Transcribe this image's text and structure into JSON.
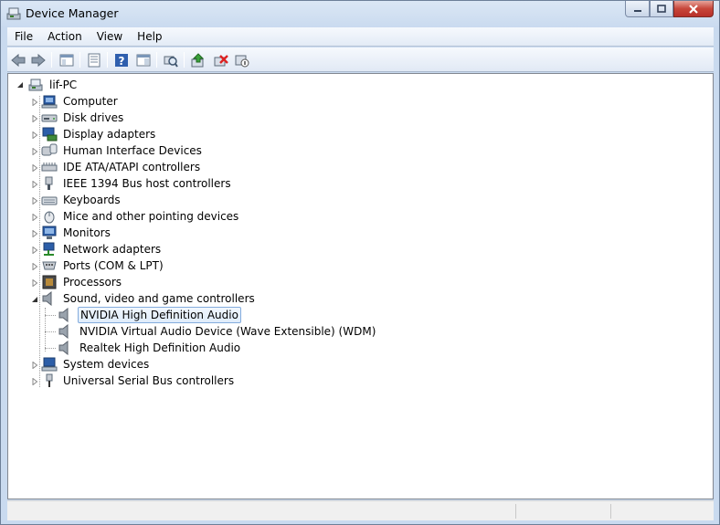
{
  "window": {
    "title": "Device Manager"
  },
  "menu": [
    "File",
    "Action",
    "View",
    "Help"
  ],
  "toolbar_icons": [
    "back-arrow-icon",
    "forward-arrow-icon",
    "show-hide-console-tree-icon",
    "properties-icon",
    "help-icon",
    "action-pane-icon",
    "scan-hardware-icon",
    "update-driver-icon",
    "uninstall-icon",
    "disable-device-icon"
  ],
  "tree": {
    "root": "lif-PC",
    "categories": [
      {
        "label": "Computer",
        "icon": "computer-icon"
      },
      {
        "label": "Disk drives",
        "icon": "disk-drive-icon"
      },
      {
        "label": "Display adapters",
        "icon": "display-adapter-icon"
      },
      {
        "label": "Human Interface Devices",
        "icon": "hid-icon"
      },
      {
        "label": "IDE ATA/ATAPI controllers",
        "icon": "ide-controller-icon"
      },
      {
        "label": "IEEE 1394 Bus host controllers",
        "icon": "ieee1394-icon"
      },
      {
        "label": "Keyboards",
        "icon": "keyboard-icon"
      },
      {
        "label": "Mice and other pointing devices",
        "icon": "mouse-icon"
      },
      {
        "label": "Monitors",
        "icon": "monitor-icon"
      },
      {
        "label": "Network adapters",
        "icon": "network-adapter-icon"
      },
      {
        "label": "Ports (COM & LPT)",
        "icon": "port-icon"
      },
      {
        "label": "Processors",
        "icon": "processor-icon"
      },
      {
        "label": "Sound, video and game controllers",
        "icon": "speaker-icon"
      }
    ],
    "sound_children": [
      {
        "label": "NVIDIA High Definition Audio",
        "selected": true
      },
      {
        "label": "NVIDIA Virtual Audio Device (Wave Extensible) (WDM)",
        "selected": false
      },
      {
        "label": "Realtek High Definition Audio",
        "selected": false
      }
    ],
    "after": [
      {
        "label": "System devices",
        "icon": "system-devices-icon"
      },
      {
        "label": "Universal Serial Bus controllers",
        "icon": "usb-icon"
      }
    ]
  },
  "colors": {
    "selection_border": "#84acdd",
    "selection_fill": "#dfecfb",
    "titlebar": "#c9daef",
    "close_button": "#c7463a"
  }
}
